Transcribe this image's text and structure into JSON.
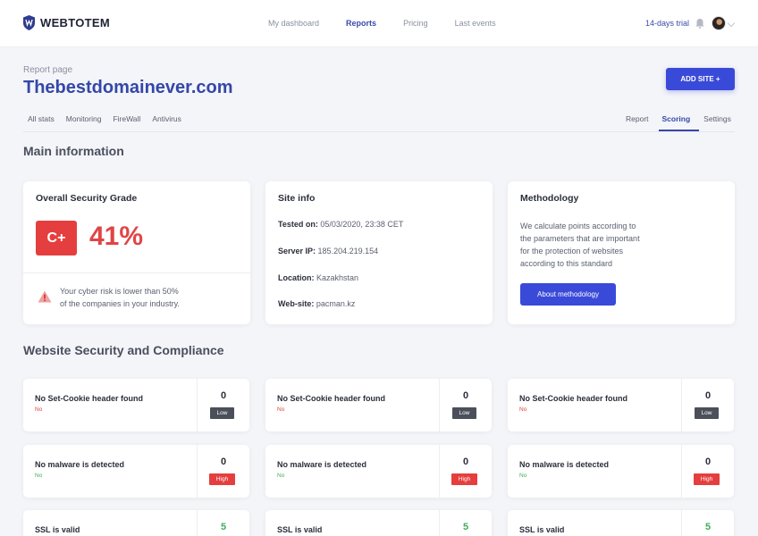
{
  "brand": {
    "name": "WEBTOTEM"
  },
  "nav": {
    "items": [
      "My dashboard",
      "Reports",
      "Pricing",
      "Last events"
    ],
    "active": "Reports"
  },
  "header_right": {
    "trial": "14-days trial"
  },
  "page": {
    "label": "Report page",
    "domain": "Thebestdomainever.com",
    "add_site": "ADD SITE +"
  },
  "tabs_left": [
    "All stats",
    "Monitoring",
    "FireWall",
    "Antivirus"
  ],
  "tabs_right": [
    "Report",
    "Scoring",
    "Settings"
  ],
  "active_tab": "Scoring",
  "main_info": {
    "title": "Main information",
    "grade_card": {
      "title": "Overall Security Grade",
      "grade": "C+",
      "percent": "41%",
      "risk_line1": "Your cyber risk is lower than 50%",
      "risk_line2": "of the companies in your industry."
    },
    "site_info": {
      "title": "Site info",
      "tested_label": "Tested on:",
      "tested_value": "05/03/2020, 23:38 CET",
      "ip_label": "Server IP:",
      "ip_value": "185.204.219.154",
      "location_label": "Location:",
      "location_value": "Kazakhstan",
      "website_label": "Web-site:",
      "website_value": "pacman.kz"
    },
    "methodology": {
      "title": "Methodology",
      "line1": "We calculate points according to",
      "line2": "the parameters that are important",
      "line3": "for the protection of websites",
      "line4": "according to this standard",
      "button": "About methodology"
    }
  },
  "compliance": {
    "title": "Website Security and Compliance",
    "rows": [
      {
        "title": "No Set-Cookie header found",
        "sub": "No",
        "score": "0",
        "badge": "Low"
      },
      {
        "title": "No malware is detected",
        "sub": "No",
        "score": "0",
        "badge": "High"
      },
      {
        "title": "SSL is valid",
        "sub": "",
        "score": "5",
        "badge": ""
      }
    ]
  },
  "colors": {
    "accent": "#3a4ad8",
    "brand_blue": "#3447a8",
    "danger": "#e53e3e",
    "success": "#3fae5a",
    "low_badge": "#4b4f5a"
  }
}
